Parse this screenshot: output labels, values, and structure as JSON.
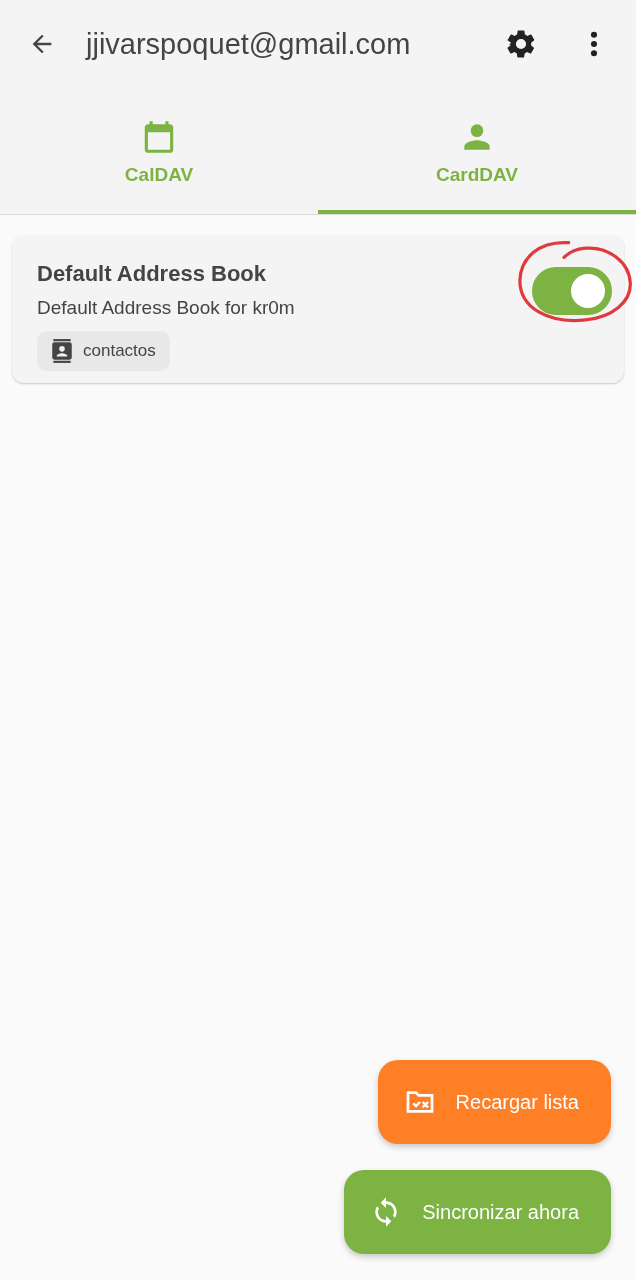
{
  "app_bar": {
    "title": "jjivarspoquet@gmail.com"
  },
  "tabs": [
    {
      "label": "CalDAV",
      "kind": "calendar",
      "selected": false
    },
    {
      "label": "CardDAV",
      "kind": "contacts",
      "selected": true
    }
  ],
  "collections": [
    {
      "title": "Default Address Book",
      "description": "Default Address Book for kr0m",
      "chip": "contactos",
      "enabled": true,
      "highlighted": true
    }
  ],
  "actions": [
    {
      "label": "Recargar lista",
      "kind": "reload",
      "color": "#ff7f27"
    },
    {
      "label": "Sincronizar ahora",
      "kind": "sync",
      "color": "#7cb342"
    }
  ]
}
